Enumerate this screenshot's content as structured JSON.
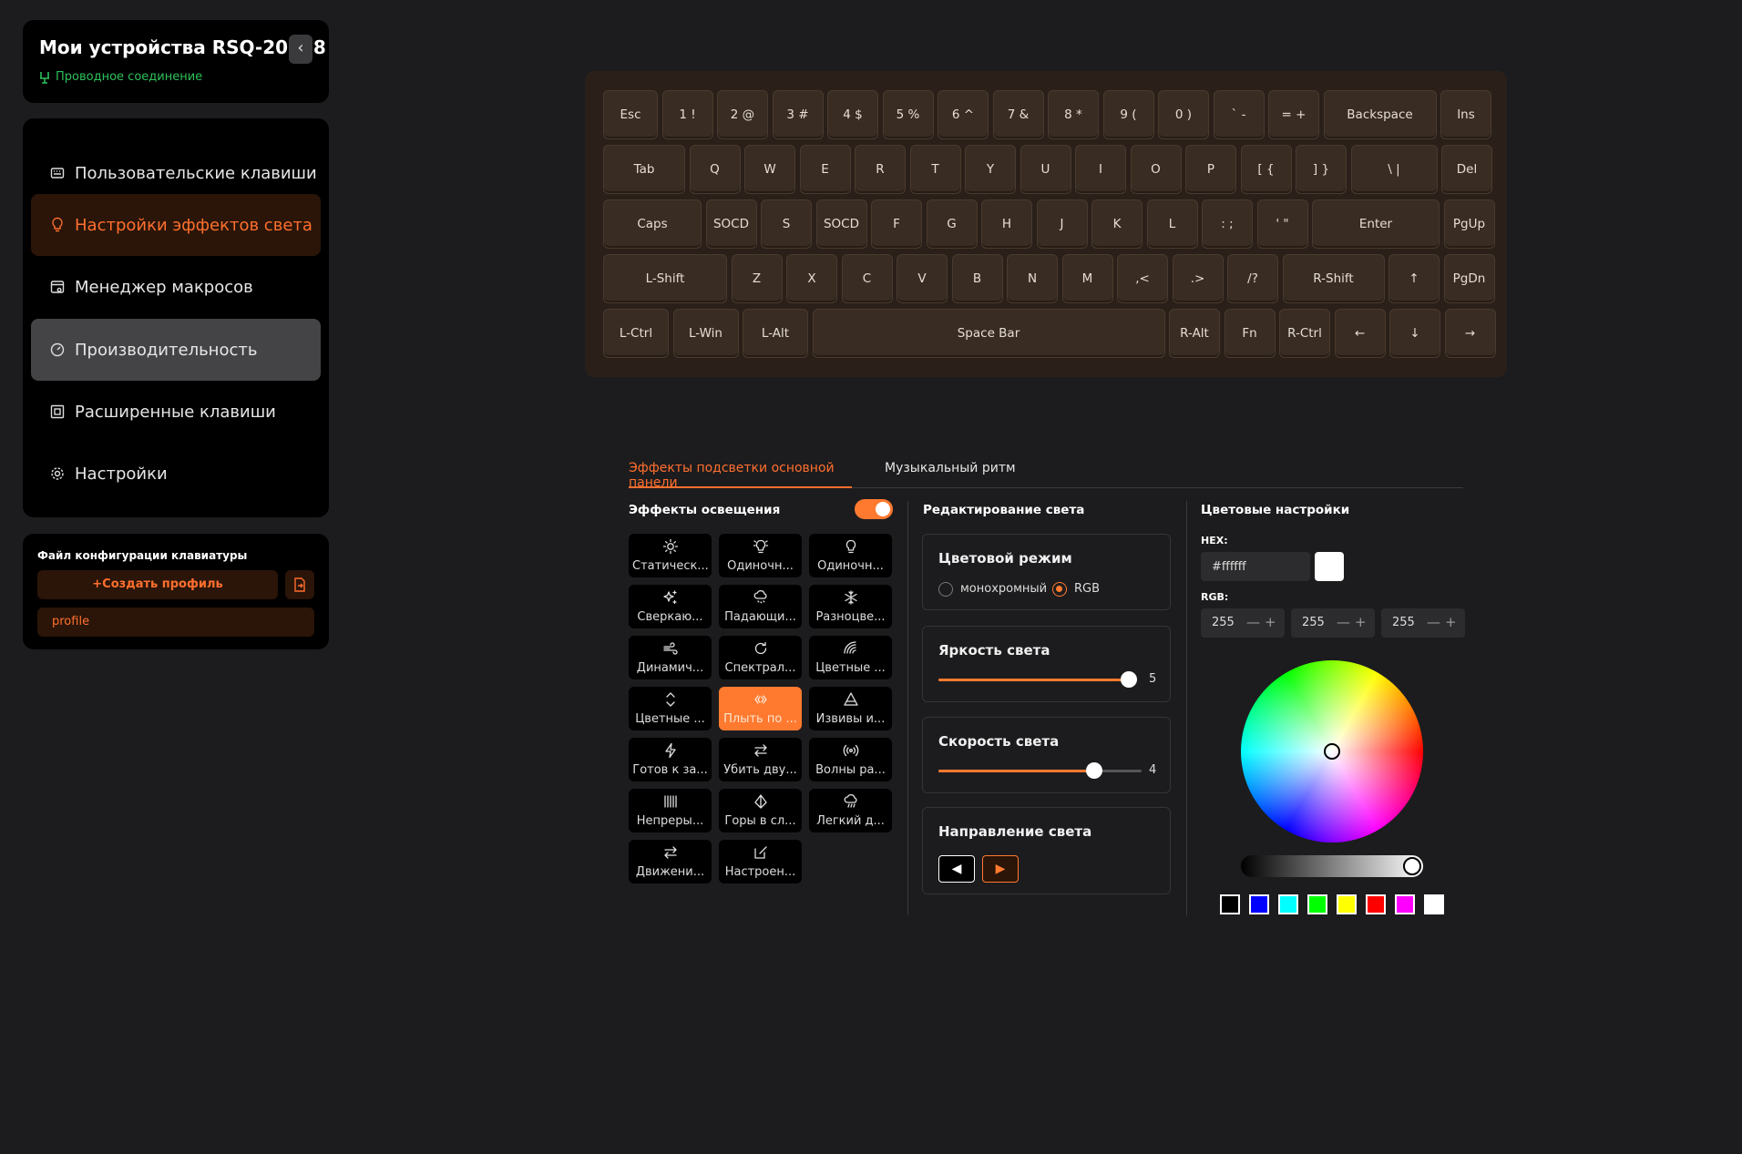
{
  "device": {
    "title": "Мои устройства RSQ-20058",
    "connection": "Проводное соединение",
    "collapse_icon": "chevron-left-icon"
  },
  "nav": {
    "items": [
      {
        "label": "Пользовательские клавиши",
        "icon": "custom-keys-icon",
        "state": ""
      },
      {
        "label": "Настройки эффектов света",
        "icon": "bulb-icon",
        "state": "active"
      },
      {
        "label": "Менеджер макросов",
        "icon": "macro-icon",
        "state": ""
      },
      {
        "label": "Производительность",
        "icon": "gauge-icon",
        "state": "hover"
      },
      {
        "label": "Расширенные клавиши",
        "icon": "advanced-keys-icon",
        "state": ""
      },
      {
        "label": "Настройки",
        "icon": "gear-icon",
        "state": ""
      }
    ]
  },
  "profiles": {
    "title": "Файл конфигурации клавиатуры",
    "create_label": "Создать профиль",
    "create_prefix": "+",
    "items": [
      "profile"
    ]
  },
  "keyboard": {
    "rows": [
      [
        "Esc",
        "1 !",
        "2 @",
        "3 #",
        "4 $",
        "5 %",
        "6 ^",
        "7 &",
        "8 *",
        "9 (",
        "0 )",
        "` -",
        "= +",
        "Backspace",
        "Ins"
      ],
      [
        "Tab",
        "Q",
        "W",
        "E",
        "R",
        "T",
        "Y",
        "U",
        "I",
        "O",
        "P",
        "[ {",
        "] }",
        "\\ |",
        "Del"
      ],
      [
        "Caps",
        "SOCD",
        "S",
        "SOCD",
        "F",
        "G",
        "H",
        "J",
        "K",
        "L",
        ": ;",
        "' \"",
        "Enter",
        "PgUp"
      ],
      [
        "L-Shift",
        "Z",
        "X",
        "C",
        "V",
        "B",
        "N",
        "M",
        ",<",
        ".>",
        "/?",
        "R-Shift",
        "↑",
        "PgDn"
      ],
      [
        "L-Ctrl",
        "L-Win",
        "L-Alt",
        "Space Bar",
        "R-Alt",
        "Fn",
        "R-Ctrl",
        "←",
        "↓",
        "→"
      ]
    ]
  },
  "tabs": {
    "main": "Эффекты подсветки основной панели",
    "music": "Музыкальный ритм"
  },
  "effects": {
    "title": "Эффекты освещения",
    "enabled": true,
    "items": [
      {
        "label": "Статическ...",
        "icon": "sun-icon"
      },
      {
        "label": "Одиночн...",
        "icon": "bulb-icon"
      },
      {
        "label": "Одиночн...",
        "icon": "bulb-outline-icon"
      },
      {
        "label": "Сверкаю...",
        "icon": "sparkle-icon"
      },
      {
        "label": "Падающи...",
        "icon": "snow-cloud-icon"
      },
      {
        "label": "Разноцве...",
        "icon": "snowflake-icon"
      },
      {
        "label": "Динамич...",
        "icon": "wind-icon"
      },
      {
        "label": "Спектрал...",
        "icon": "cycle-icon"
      },
      {
        "label": "Цветные ...",
        "icon": "rainbow-icon"
      },
      {
        "label": "Цветные ...",
        "icon": "up-down-icon"
      },
      {
        "label": "Плыть по ...",
        "icon": "flow-icon",
        "selected": true
      },
      {
        "label": "Извивы и...",
        "icon": "triangle-icon"
      },
      {
        "label": "Готов к за...",
        "icon": "bolt-icon"
      },
      {
        "label": "Убить дву...",
        "icon": "swap-icon"
      },
      {
        "label": "Волны ра...",
        "icon": "waves-icon"
      },
      {
        "label": "Непреры...",
        "icon": "stripes-icon"
      },
      {
        "label": "Горы в сл...",
        "icon": "mountain-icon"
      },
      {
        "label": "Легкий д...",
        "icon": "rain-cloud-icon"
      },
      {
        "label": "Движени...",
        "icon": "arrows-icon"
      },
      {
        "label": "Настроен...",
        "icon": "edit-icon"
      }
    ]
  },
  "edit": {
    "title": "Редактирование света",
    "color_mode": {
      "title": "Цветовой режим",
      "options": [
        "монохромный",
        "RGB"
      ],
      "selected": "RGB"
    },
    "brightness": {
      "title": "Яркость света",
      "value": 5,
      "max": 5
    },
    "speed": {
      "title": "Скорость света",
      "value": 4,
      "max": 5
    },
    "direction": {
      "title": "Направление света",
      "left_icon": "play-left-icon",
      "right_icon": "play-right-icon",
      "selected": "right"
    }
  },
  "color": {
    "title": "Цветовые настройки",
    "hex_label": "HEX:",
    "hex_value": "#ffffff",
    "rgb_label": "RGB:",
    "r": "255",
    "g": "255",
    "b": "255",
    "minus": "—",
    "plus": "+",
    "brightness_level": 1.0,
    "presets": [
      "#000000",
      "#0000ff",
      "#00ffff",
      "#00ff00",
      "#ffff00",
      "#ff0000",
      "#ff00ff",
      "#ffffff"
    ]
  },
  "colors": {
    "accent": "#ff7a2f",
    "active_nav_bg": "#2a1508",
    "connected": "#2ec05a"
  }
}
